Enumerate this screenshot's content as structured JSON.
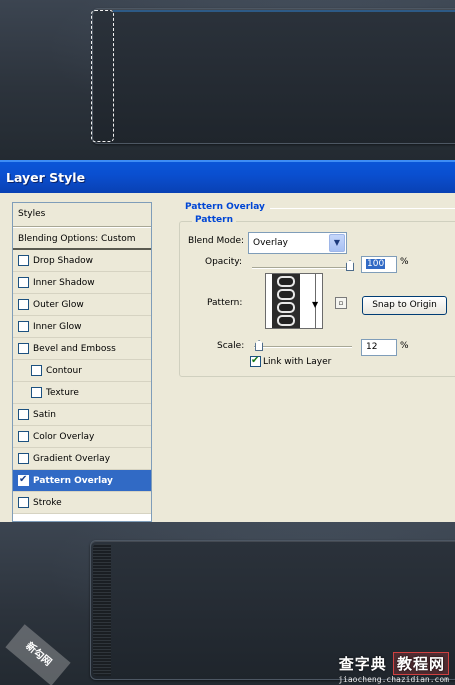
{
  "dialog": {
    "title": "Layer Style"
  },
  "styles_list": {
    "header": "Styles",
    "blending": "Blending Options: Custom",
    "items": [
      {
        "label": "Drop Shadow",
        "checked": false,
        "sub": false,
        "active": false
      },
      {
        "label": "Inner Shadow",
        "checked": false,
        "sub": false,
        "active": false
      },
      {
        "label": "Outer Glow",
        "checked": false,
        "sub": false,
        "active": false
      },
      {
        "label": "Inner Glow",
        "checked": false,
        "sub": false,
        "active": false
      },
      {
        "label": "Bevel and Emboss",
        "checked": false,
        "sub": false,
        "active": false
      },
      {
        "label": "Contour",
        "checked": false,
        "sub": true,
        "active": false
      },
      {
        "label": "Texture",
        "checked": false,
        "sub": true,
        "active": false
      },
      {
        "label": "Satin",
        "checked": false,
        "sub": false,
        "active": false
      },
      {
        "label": "Color Overlay",
        "checked": false,
        "sub": false,
        "active": false
      },
      {
        "label": "Gradient Overlay",
        "checked": false,
        "sub": false,
        "active": false
      },
      {
        "label": "Pattern Overlay",
        "checked": true,
        "sub": false,
        "active": true
      },
      {
        "label": "Stroke",
        "checked": false,
        "sub": false,
        "active": false
      }
    ]
  },
  "pattern_overlay": {
    "section_title": "Pattern Overlay",
    "group_title": "Pattern",
    "blend_mode_label": "Blend Mode:",
    "blend_mode_value": "Overlay",
    "opacity_label": "Opacity:",
    "opacity_value": "100",
    "opacity_unit": "%",
    "opacity_level": 100,
    "pattern_label": "Pattern:",
    "snap_button": "Snap to Origin",
    "scale_label": "Scale:",
    "scale_value": "12",
    "scale_unit": "%",
    "scale_level": 12,
    "link_label": "Link with Layer",
    "link_checked": true
  },
  "watermark": {
    "left_text": "新勾网",
    "site_name": "查字典",
    "site_box": "教程网",
    "url": "jiaocheng.chazidian.com"
  },
  "colors": {
    "titlebar": "#0a4fd0",
    "selection": "#316ac5",
    "dialog_bg": "#ece9d8",
    "section_title": "#0046d5"
  }
}
